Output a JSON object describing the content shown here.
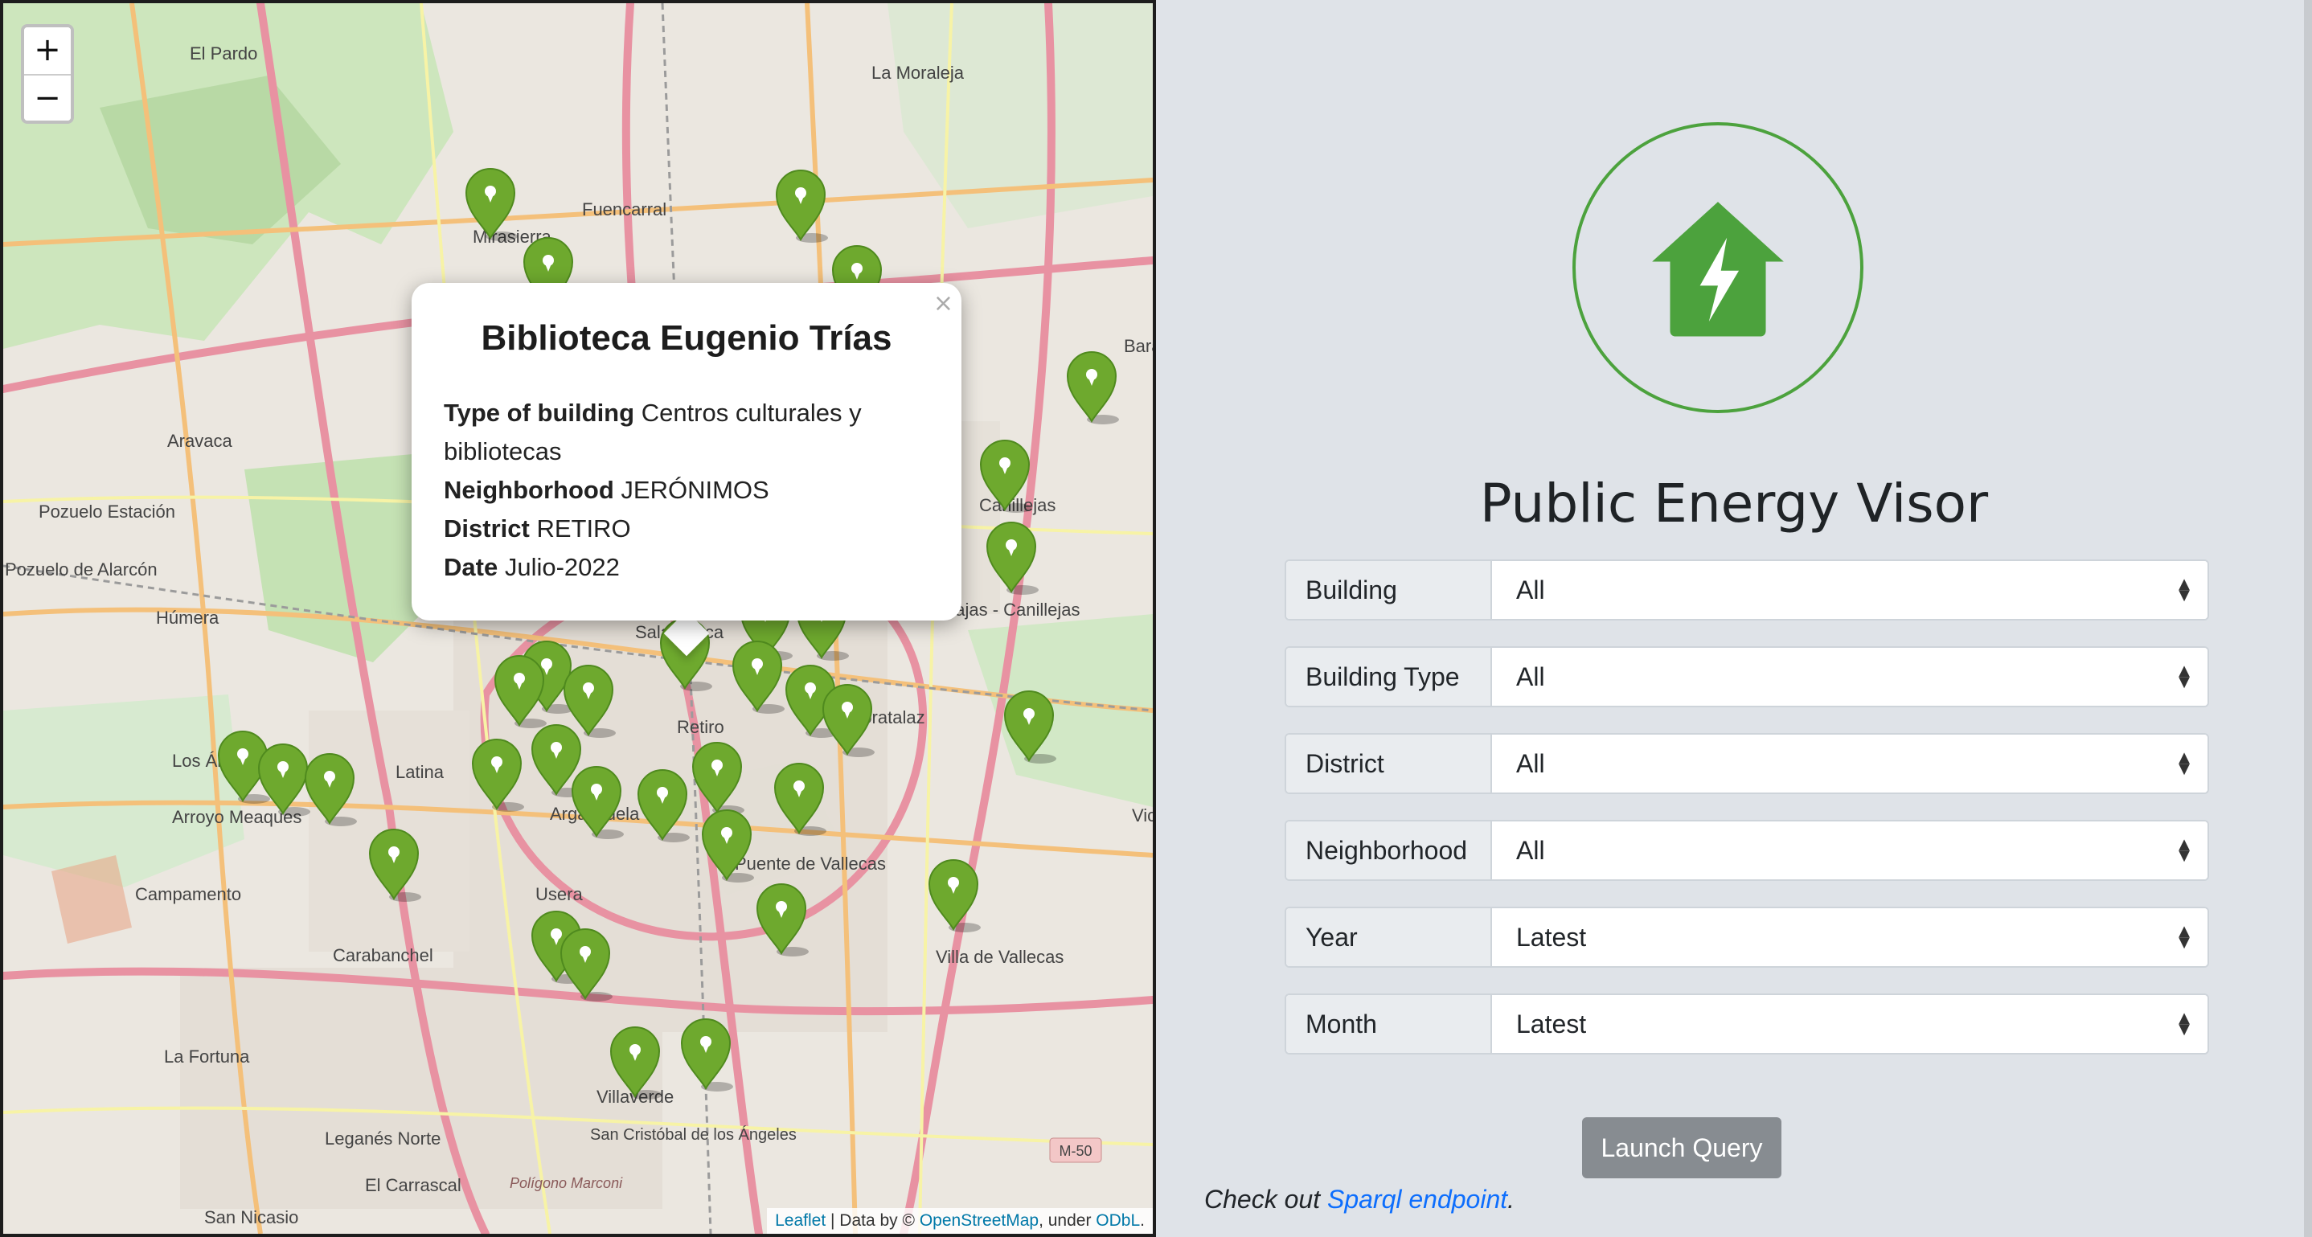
{
  "map": {
    "zoom_in": "+",
    "zoom_out": "−",
    "place_labels": [
      "El Pardo",
      "La Moraleja",
      "Fuencarral",
      "Mirasierra",
      "Aravaca",
      "Pozuelo Estación",
      "Pozuelo de Alarcón",
      "Húmera",
      "Canillejas",
      "Barajas - Canillejas",
      "Salamanca",
      "Retiro",
      "Moratalaz",
      "Latina",
      "Arroyo Meaques",
      "Campamento",
      "Carabanchel",
      "Usera",
      "Arganzuela",
      "Puente de Vallecas",
      "Villa de Vallecas",
      "La Fortuna",
      "Leganés Norte",
      "Villaverde",
      "San Cristóbal de los Ángeles",
      "El Carrascal",
      "San Nicasio",
      "Polígono Marconi",
      "M-50",
      "Los Ángeles",
      "Vic",
      "Bara"
    ],
    "marker_icon": "map-marker-icon",
    "marker_color": "#6ea92e",
    "popup": {
      "close": "×",
      "title": "Biblioteca Eugenio Trías",
      "type_label": "Type of building",
      "type_value": "Centros culturales y bibliotecas",
      "neighborhood_label": "Neighborhood",
      "neighborhood_value": "JERÓNIMOS",
      "district_label": "District",
      "district_value": "RETIRO",
      "date_label": "Date",
      "date_value": "Julio-2022"
    },
    "attribution": {
      "leaflet": "Leaflet",
      "sep1": " | Data by © ",
      "osm": "OpenStreetMap",
      "sep2": ", under ",
      "odbl": "ODbL",
      "end": "."
    }
  },
  "panel": {
    "logo_icon": "house-bolt-icon",
    "accent": "#4ca23d",
    "title": "Public Energy Visor",
    "filters": [
      {
        "label": "Building",
        "value": "All"
      },
      {
        "label": "Building Type",
        "value": "All"
      },
      {
        "label": "District",
        "value": "All"
      },
      {
        "label": "Neighborhood",
        "value": "All"
      },
      {
        "label": "Year",
        "value": "Latest"
      },
      {
        "label": "Month",
        "value": "Latest"
      }
    ],
    "launch_label": "Launch Query",
    "footer_prefix": "Check out ",
    "footer_link": "Sparql endpoint",
    "footer_suffix": "."
  }
}
